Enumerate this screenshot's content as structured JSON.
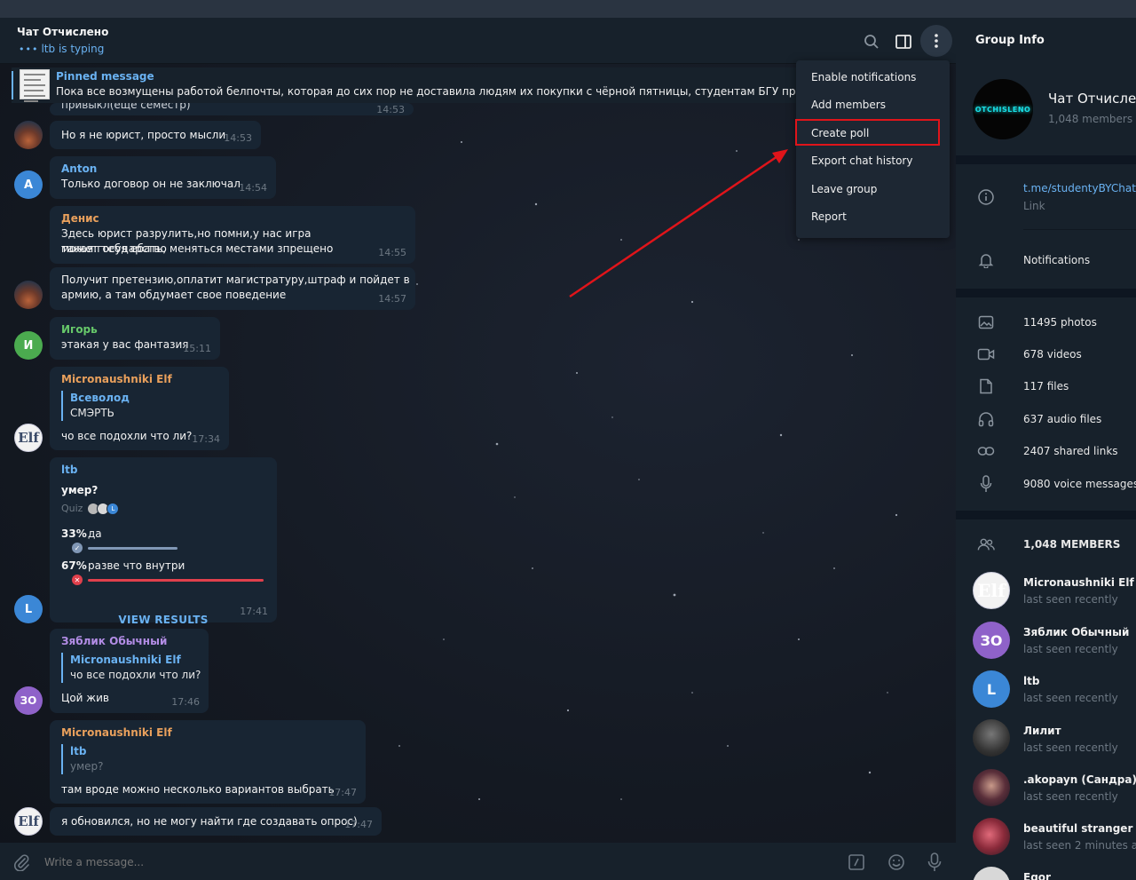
{
  "header": {
    "title": "Чат Отчислено",
    "typing": "ltb is typing",
    "dots": "•••"
  },
  "pinned": {
    "title": "Pinned message",
    "text": "Пока все возмущены работой белпочты, которая до сих пор не доставила людям их покупки с чёрной пятницы, студентам БГУ предлагают"
  },
  "messages": {
    "m0": {
      "text": "привыкл(еще семестр)",
      "time": "14:53"
    },
    "m1": {
      "text": "Но я не юрист, просто мысли",
      "time": "14:53"
    },
    "m2": {
      "name": "Anton",
      "text": "Только договор он не заключал",
      "time": "14:54",
      "avatar": "A"
    },
    "m3": {
      "name": "Денис",
      "line1": "Здесь юрист разрулить,но помни,у нас игра такая:государство",
      "line2": "может тебя ебать, меняться местами зпрещено",
      "time": "14:55"
    },
    "m4": {
      "line1": "Получит претензию,оплатит магистратуру,штраф и пойдет в",
      "line2": "армию, а там обдумает свое поведение",
      "time": "14:57"
    },
    "m5": {
      "name": "Игорь",
      "text": "этакая у вас фантазия",
      "time": "15:11",
      "avatar": "И"
    },
    "m6": {
      "name": "Micronaushniki Elf",
      "reply_name": "Всеволод",
      "reply_text": "СМЭРТЬ",
      "text": "чо все подохли что ли?",
      "time": "17:34",
      "avatar": "Elf"
    },
    "m7": {
      "name": "ltb",
      "question": "умер?",
      "type": "Quiz",
      "options": [
        {
          "pct": "33%",
          "label": "да",
          "mark": "✓"
        },
        {
          "pct": "67%",
          "label": "разве что внутри",
          "mark": "✕"
        }
      ],
      "results": "VIEW RESULTS",
      "time": "17:41",
      "avatar": "L",
      "voter_initial": "L"
    },
    "m8": {
      "name": "Зяблик Обычный",
      "reply_name": "Micronaushniki Elf",
      "reply_text": "чо все подохли что ли?",
      "text": "Цой жив",
      "time": "17:46",
      "avatar": "ЗО"
    },
    "m9": {
      "name": "Micronaushniki Elf",
      "reply_name": "ltb",
      "reply_text": "умер?",
      "text": "там вроде можно несколько вариантов выбрать",
      "time": "17:47"
    },
    "m10": {
      "text": "я обновился, но не могу найти где создавать опрос)",
      "time": "17:47",
      "avatar": "Elf"
    }
  },
  "composer": {
    "placeholder": "Write a message..."
  },
  "menu": {
    "items": [
      "Enable notifications",
      "Add members",
      "Create poll",
      "Export chat history",
      "Leave group",
      "Report"
    ]
  },
  "panel": {
    "title": "Group Info",
    "avatar_text": "OTCHISLENO",
    "group_name": "Чат Отчисленo",
    "members_count": "1,048 members",
    "link": "t.me/studentyBYChat",
    "link_label": "Link",
    "notifications": "Notifications",
    "media": [
      "11495 photos",
      "678 videos",
      "117 files",
      "637 audio files",
      "2407 shared links",
      "9080 voice messages"
    ],
    "members_header": "1,048 MEMBERS",
    "members": [
      {
        "name": "Micronaushniki Elf",
        "status": "last seen recently",
        "initials": "Elf"
      },
      {
        "name": "Зяблик Обычный",
        "status": "last seen recently",
        "initials": "ЗО"
      },
      {
        "name": "ltb",
        "status": "last seen recently",
        "initials": "L"
      },
      {
        "name": "Лилит",
        "status": "last seen recently"
      },
      {
        "name": ".akopayn (Сандра)",
        "status": "last seen recently"
      },
      {
        "name": "beautiful stranger #П",
        "status": "last seen 2 minutes ago"
      },
      {
        "name": "Egor"
      }
    ]
  },
  "colors": {
    "accent": "#6ab2f2",
    "highlight_box": "#e0141a",
    "annotation_arrow": "#e0141a",
    "name_anton": "#6ab2f2",
    "name_denis": "#e9a05c",
    "name_igor": "#67c96a",
    "name_elf": "#e9a05c",
    "name_ltb": "#6ab2f2",
    "name_zyablik": "#b38de6",
    "poll_correct": "#8097b5",
    "poll_wrong": "#e0404c"
  }
}
